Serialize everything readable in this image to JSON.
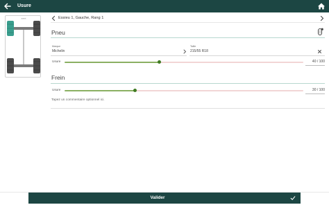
{
  "header": {
    "title": "Usure",
    "back_icon": "arrow-left-icon",
    "home_icon": "home-icon"
  },
  "vehicle_diagram": {
    "front_label": "avant",
    "selected_wheel": "front-left"
  },
  "navigation": {
    "position_label": "Essieu 1, Gauche, Rang 1"
  },
  "tire": {
    "section_title": "Pneu",
    "brand_label": "Marque",
    "brand_value": "Michelin",
    "size_label": "Taille",
    "size_value": "215/55 R18",
    "wear_label": "Usure",
    "wear_value": 40,
    "wear_max": 100,
    "wear_display": "40 / 100"
  },
  "brake": {
    "section_title": "Frein",
    "wear_label": "Usure",
    "wear_value": 30,
    "wear_max": 100,
    "wear_display": "30 / 100"
  },
  "comment": {
    "placeholder": "Tapez un commentaire optionnel ici."
  },
  "footer": {
    "validate_label": "Valider"
  },
  "colors": {
    "primary": "#1c4643",
    "selected_wheel": "#3a9e8e",
    "slider_fill": "#8ab062",
    "slider_thumb": "#3f7a22",
    "slider_rest": "#f2d5d5",
    "section_line": "#b7d7cf"
  }
}
